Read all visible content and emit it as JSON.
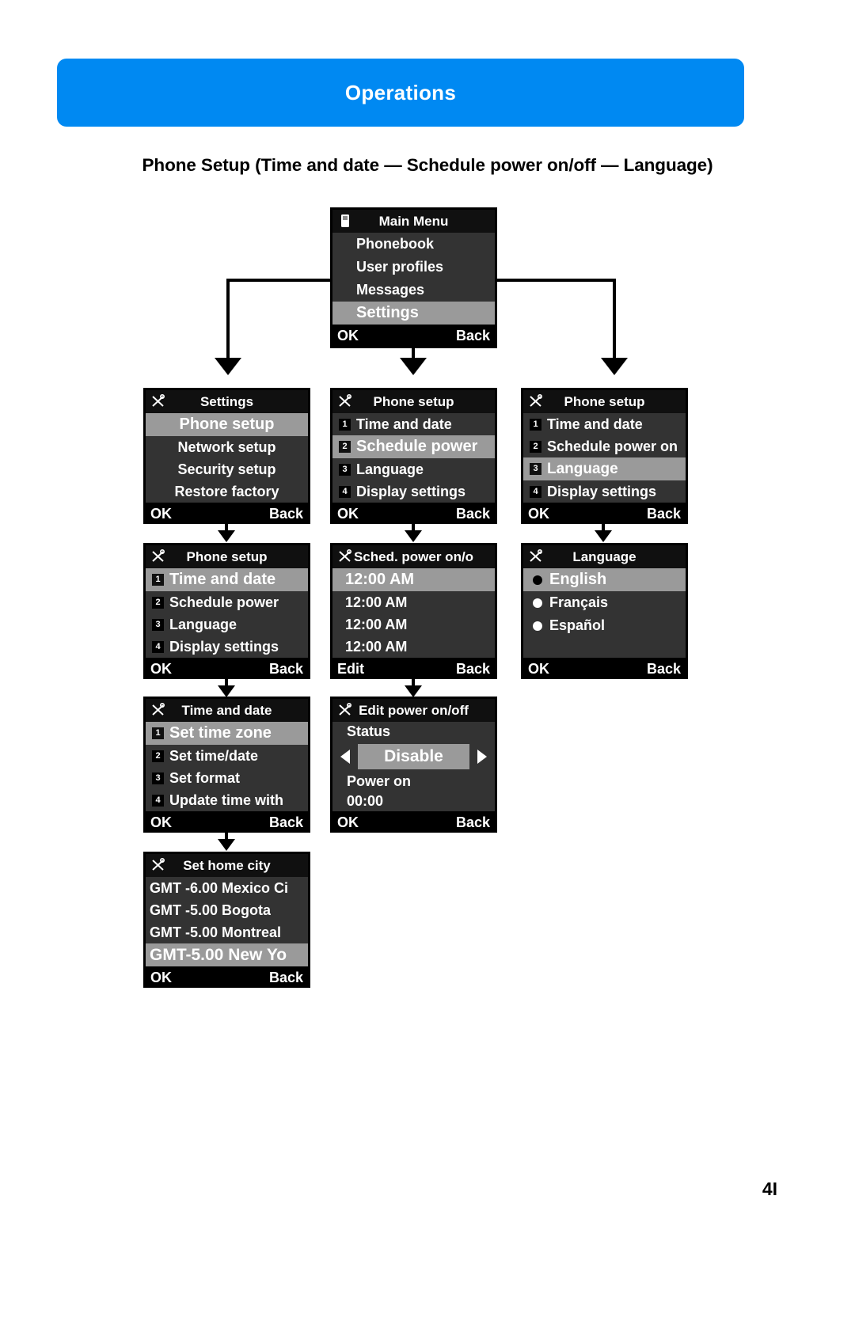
{
  "banner": {
    "title": "Operations"
  },
  "section": {
    "heading": "Phone Setup (Time and date — Schedule power on/off — Language)"
  },
  "page": {
    "number": "4I"
  },
  "softkeys": {
    "ok": "OK",
    "back": "Back",
    "edit": "Edit"
  },
  "screens": {
    "main_menu": {
      "title": "Main Menu",
      "icon": "sim-card-icon",
      "items": [
        {
          "label": "Phonebook",
          "selected": false
        },
        {
          "label": "User profiles",
          "selected": false
        },
        {
          "label": "Messages",
          "selected": false
        },
        {
          "label": "Settings",
          "selected": true
        }
      ],
      "left_key": "OK",
      "right_key": "Back"
    },
    "settings": {
      "title": "Settings",
      "icon": "tools-icon",
      "items": [
        {
          "label": "Phone setup",
          "selected": true
        },
        {
          "label": "Network setup",
          "selected": false
        },
        {
          "label": "Security setup",
          "selected": false
        },
        {
          "label": "Restore factory",
          "selected": false
        }
      ],
      "left_key": "OK",
      "right_key": "Back"
    },
    "phone_setup_a": {
      "title": "Phone setup",
      "icon": "tools-icon",
      "items": [
        {
          "num": "1",
          "label": "Time and date",
          "selected": true
        },
        {
          "num": "2",
          "label": "Schedule power",
          "selected": false
        },
        {
          "num": "3",
          "label": "Language",
          "selected": false
        },
        {
          "num": "4",
          "label": "Display settings",
          "selected": false
        }
      ],
      "left_key": "OK",
      "right_key": "Back"
    },
    "phone_setup_b": {
      "title": "Phone setup",
      "icon": "tools-icon",
      "items": [
        {
          "num": "1",
          "label": "Time and date",
          "selected": false
        },
        {
          "num": "2",
          "label": "Schedule power",
          "selected": true
        },
        {
          "num": "3",
          "label": "Language",
          "selected": false
        },
        {
          "num": "4",
          "label": "Display settings",
          "selected": false
        }
      ],
      "left_key": "OK",
      "right_key": "Back"
    },
    "phone_setup_c": {
      "title": "Phone setup",
      "icon": "tools-icon",
      "items": [
        {
          "num": "1",
          "label": "Time and date",
          "selected": false
        },
        {
          "num": "2",
          "label": "Schedule power on",
          "selected": false
        },
        {
          "num": "3",
          "label": "Language",
          "selected": true
        },
        {
          "num": "4",
          "label": "Display settings",
          "selected": false
        }
      ],
      "left_key": "OK",
      "right_key": "Back"
    },
    "time_and_date": {
      "title": "Time and date",
      "icon": "tools-icon",
      "items": [
        {
          "num": "1",
          "label": "Set time zone",
          "selected": true
        },
        {
          "num": "2",
          "label": "Set time/date",
          "selected": false
        },
        {
          "num": "3",
          "label": "Set format",
          "selected": false
        },
        {
          "num": "4",
          "label": "Update time with",
          "selected": false
        }
      ],
      "left_key": "OK",
      "right_key": "Back"
    },
    "set_home_city": {
      "title": "Set home city",
      "icon": "tools-icon",
      "items": [
        {
          "label": "GMT -6.00 Mexico Ci",
          "selected": false
        },
        {
          "label": "GMT -5.00 Bogota",
          "selected": false
        },
        {
          "label": "GMT -5.00 Montreal",
          "selected": false
        },
        {
          "label": "GMT-5.00 New Yo",
          "selected": true
        }
      ],
      "left_key": "OK",
      "right_key": "Back"
    },
    "sched_power": {
      "title": "Sched. power on/o",
      "icon": "tools-icon",
      "items": [
        {
          "label": "12:00 AM",
          "selected": true
        },
        {
          "label": "12:00 AM",
          "selected": false
        },
        {
          "label": "12:00 AM",
          "selected": false
        },
        {
          "label": "12:00 AM",
          "selected": false
        }
      ],
      "left_key": "Edit",
      "right_key": "Back"
    },
    "edit_power": {
      "title": "Edit power on/off",
      "icon": "tools-icon",
      "status_label": "Status",
      "status_value": "Disable",
      "power_label": "Power on",
      "power_value": "00:00",
      "left_key": "OK",
      "right_key": "Back"
    },
    "language": {
      "title": "Language",
      "icon": "tools-icon",
      "items": [
        {
          "label": "English",
          "selected": true
        },
        {
          "label": "Français",
          "selected": false
        },
        {
          "label": "Español",
          "selected": false
        }
      ],
      "left_key": "OK",
      "right_key": "Back"
    }
  }
}
